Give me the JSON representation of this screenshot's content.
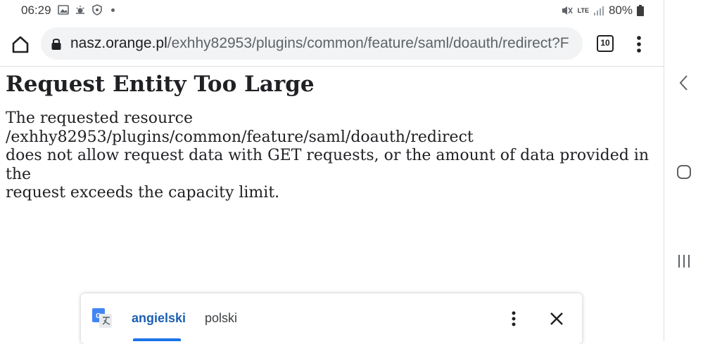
{
  "status_bar": {
    "time": "06:29",
    "network": "LTE",
    "battery": "80%"
  },
  "browser": {
    "url_host": "nasz.orange.pl",
    "url_path": "/exhhy82953/plugins/common/feature/saml/doauth/redirect?F",
    "tab_count": "10"
  },
  "page": {
    "heading": "Request Entity Too Large",
    "paragraph_lines": [
      "The requested resource",
      "/exhhy82953/plugins/common/feature/saml/doauth/redirect",
      "does not allow request data with GET requests, or the amount of data provided in the",
      "request exceeds the capacity limit."
    ]
  },
  "translate_bar": {
    "source_language": "angielski",
    "target_language": "polski"
  },
  "icons": {
    "home": "home-icon",
    "lock": "lock-icon",
    "menu": "more-vert-icon",
    "close": "close-icon",
    "translate": "google-translate-icon",
    "back": "chevron-left-icon",
    "nav_home": "circle-home-icon",
    "recents": "recents-icon"
  },
  "colors": {
    "accent": "#1a73e8",
    "active_language": "#1a5fb4",
    "urlbar_bg": "#f1f3f4"
  }
}
